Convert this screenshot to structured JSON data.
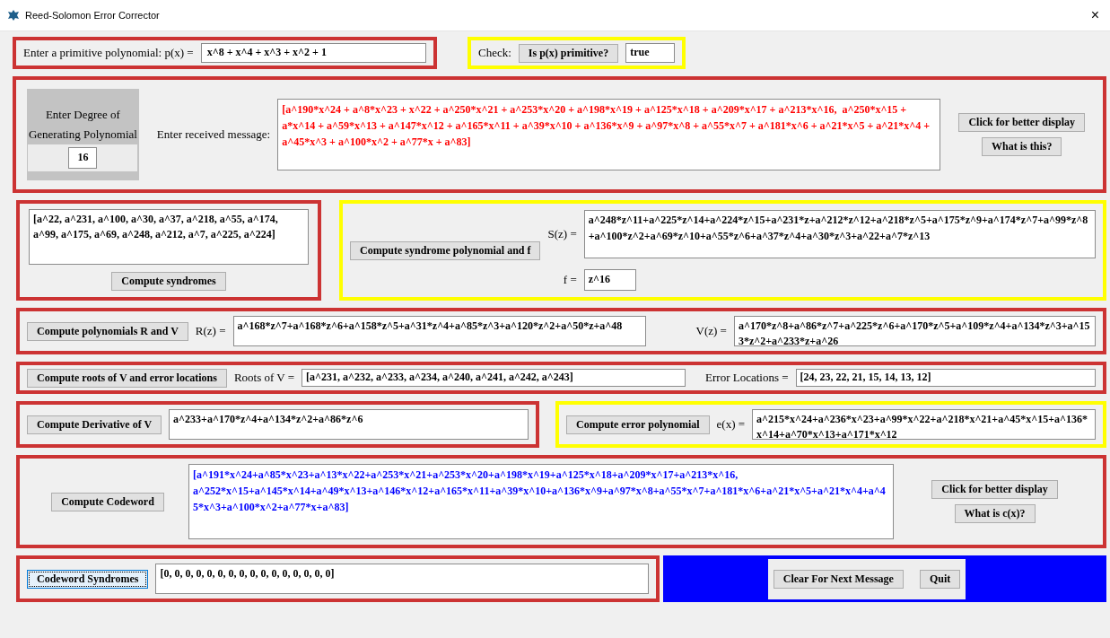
{
  "window": {
    "title": "Reed-Solomon Error Corrector",
    "close": "×"
  },
  "polynomial": {
    "label": "Enter a primitive polynomial: p(x) =",
    "value": "x^8 + x^4 + x^3 + x^2 + 1"
  },
  "check": {
    "label": "Check:",
    "button": "Is p(x) primitive?",
    "result": "true"
  },
  "degree": {
    "label": "Enter Degree of Generating Polynomial",
    "value": "16"
  },
  "received": {
    "label": "Enter received message:",
    "value": "[a^190*x^24 + a^8*x^23 + x^22 + a^250*x^21 + a^253*x^20 + a^198*x^19 + a^125*x^18 + a^209*x^17 + a^213*x^16,  a^250*x^15 + a*x^14 + a^59*x^13 + a^147*x^12 + a^165*x^11 + a^39*x^10 + a^136*x^9 + a^97*x^8 + a^55*x^7 + a^181*x^6 + a^21*x^5 + a^21*x^4 + a^45*x^3 + a^100*x^2 + a^77*x + a^83]",
    "buttons": [
      "Click for better display",
      "What is this?"
    ]
  },
  "syndromes": {
    "value": "[a^22, a^231, a^100, a^30, a^37, a^218, a^55, a^174, a^99, a^175, a^69, a^248, a^212, a^7, a^225, a^224]",
    "button": "Compute syndromes"
  },
  "syndrome_polynomial": {
    "button": "Compute syndrome polynomial and f",
    "s_label": "S(z) =",
    "s_value": "a^248*z^11+a^225*z^14+a^224*z^15+a^231*z+a^212*z^12+a^218*z^5+a^175*z^9+a^174*z^7+a^99*z^8+a^100*z^2+a^69*z^10+a^55*z^6+a^37*z^4+a^30*z^3+a^22+a^7*z^13",
    "f_label": "f =",
    "f_value": "z^16"
  },
  "rv": {
    "button": "Compute polynomials R and V",
    "r_label": "R(z) =",
    "r_value": "a^168*z^7+a^168*z^6+a^158*z^5+a^31*z^4+a^85*z^3+a^120*z^2+a^50*z+a^48",
    "v_label": "V(z) =",
    "v_value": "a^170*z^8+a^86*z^7+a^225*z^6+a^170*z^5+a^109*z^4+a^134*z^3+a^153*z^2+a^233*z+a^26"
  },
  "roots": {
    "button": "Compute roots of V and error locations",
    "roots_label": "Roots of V =",
    "roots_value": "[a^231, a^232, a^233, a^234, a^240, a^241, a^242, a^243]",
    "locations_label": "Error Locations =",
    "locations_value": "[24, 23, 22, 21, 15, 14, 13, 12]"
  },
  "derivative": {
    "button": "Compute Derivative of V",
    "value": "a^233+a^170*z^4+a^134*z^2+a^86*z^6"
  },
  "error_polynomial": {
    "button": "Compute error polynomial",
    "label": "e(x) =",
    "value": "a^215*x^24+a^236*x^23+a^99*x^22+a^218*x^21+a^45*x^15+a^136*x^14+a^70*x^13+a^171*x^12"
  },
  "codeword": {
    "button": "Compute Codeword",
    "value": "[a^191*x^24+a^85*x^23+a^13*x^22+a^253*x^21+a^253*x^20+a^198*x^19+a^125*x^18+a^209*x^17+a^213*x^16, a^252*x^15+a^145*x^14+a^49*x^13+a^146*x^12+a^165*x^11+a^39*x^10+a^136*x^9+a^97*x^8+a^55*x^7+a^181*x^6+a^21*x^5+a^21*x^4+a^45*x^3+a^100*x^2+a^77*x+a^83]",
    "buttons": [
      "Click for better display",
      "What is c(x)?"
    ]
  },
  "codeword_syndromes": {
    "button": "Codeword Syndromes",
    "focused": true,
    "value": "[0, 0, 0, 0, 0, 0, 0, 0, 0, 0, 0, 0, 0, 0, 0, 0]"
  },
  "footer": {
    "buttons": [
      "Clear For Next Message",
      "Quit"
    ]
  }
}
